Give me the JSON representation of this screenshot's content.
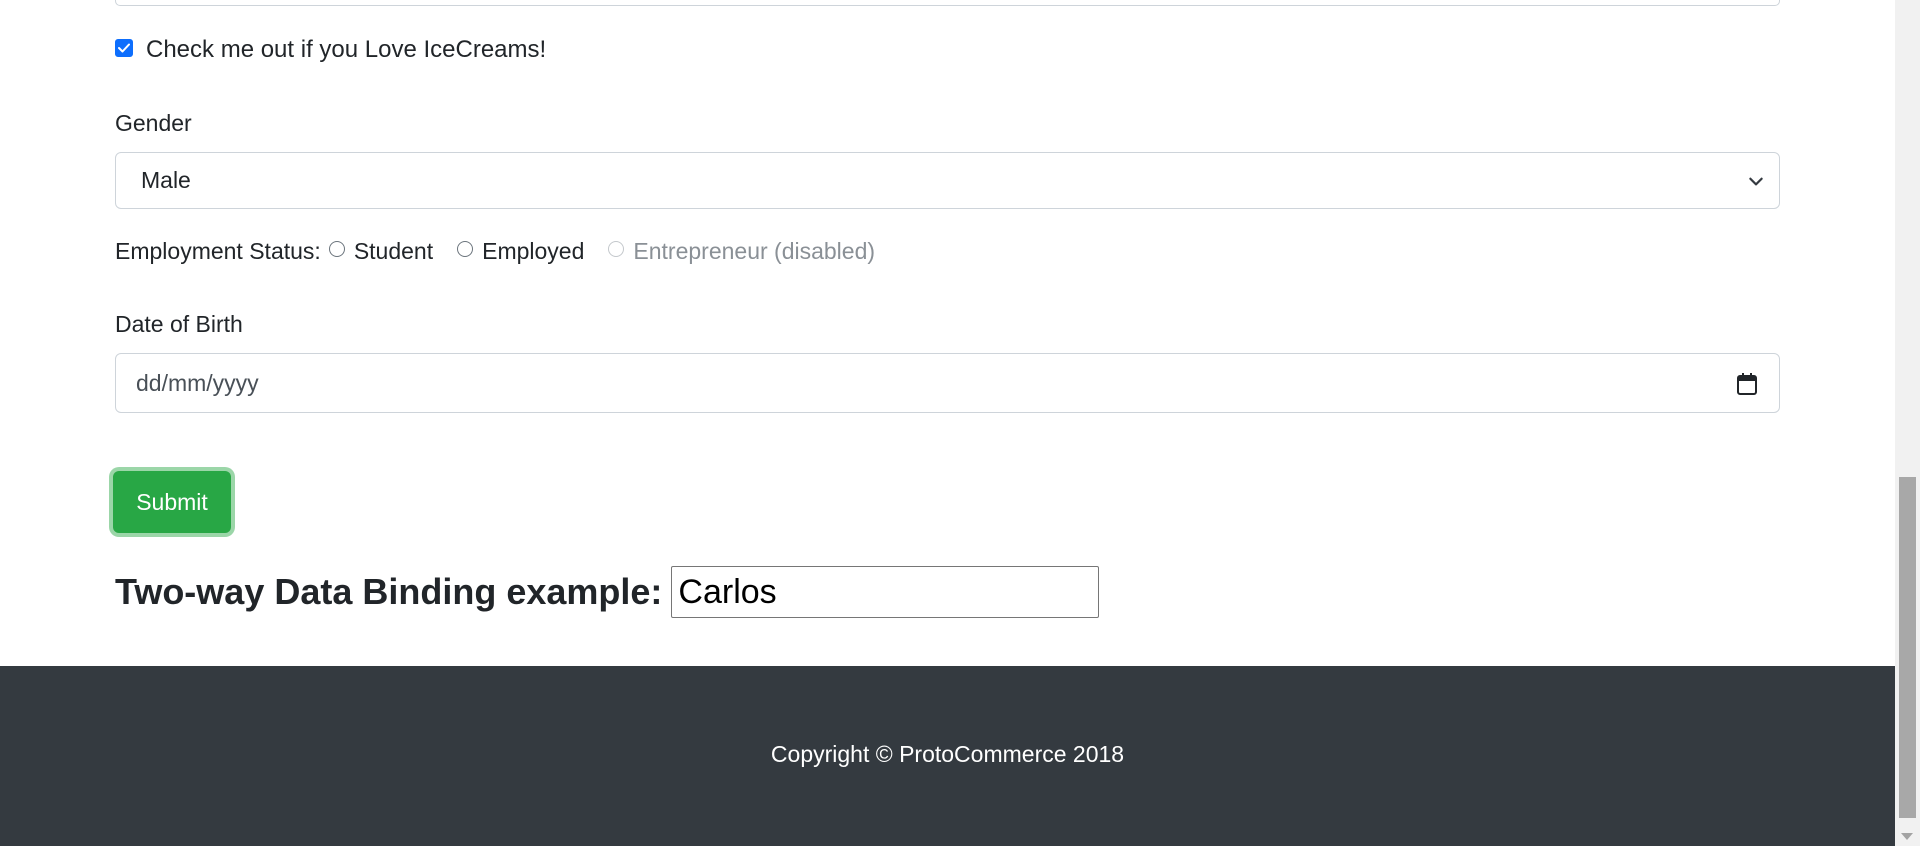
{
  "form": {
    "icecream_checkbox": {
      "label": "Check me out if you Love IceCreams!",
      "checked": true
    },
    "gender": {
      "label": "Gender",
      "selected": "Male"
    },
    "employment": {
      "label": "Employment Status:",
      "options": [
        {
          "label": "Student",
          "disabled": false
        },
        {
          "label": "Employed",
          "disabled": false
        },
        {
          "label": "Entrepreneur (disabled)",
          "disabled": true
        }
      ]
    },
    "dob": {
      "label": "Date of Birth",
      "placeholder": "dd/mm/yyyy"
    },
    "submit_label": "Submit"
  },
  "binding": {
    "title": "Two-way Data Binding example:",
    "value": "Carlos"
  },
  "footer": {
    "copyright": "Copyright © ProtoCommerce 2018"
  },
  "colors": {
    "submit": "#28a745",
    "footer_bg": "#343a40",
    "checkbox": "#0d6efd"
  },
  "icons": {
    "checkbox": "check-icon",
    "select": "chevron-down-icon",
    "date": "calendar-icon"
  }
}
